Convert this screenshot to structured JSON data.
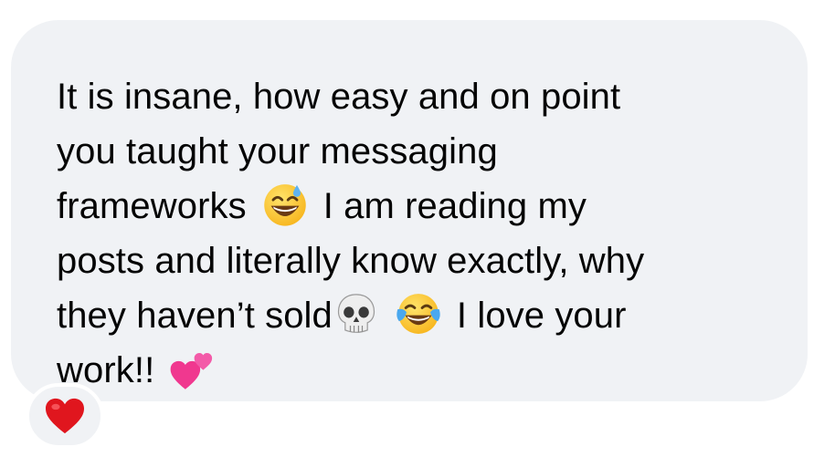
{
  "message": {
    "line1": "It is insane, how easy and on point",
    "line2": "you taught your messaging",
    "line3a": "frameworks",
    "line3b": "I am reading my",
    "line4": "posts and literally know exactly, why",
    "line5a": "they haven’t sold",
    "line5b": "I love your",
    "line6a": "work!!"
  },
  "emojis": {
    "e1": "grinning-face-with-sweat",
    "e2": "skull",
    "e3": "face-with-tears-of-joy",
    "e4": "two-hearts"
  },
  "reaction": {
    "emoji": "red-heart",
    "color": "#e0161e"
  },
  "colors": {
    "bubble": "#f0f2f5",
    "text": "#050505"
  }
}
